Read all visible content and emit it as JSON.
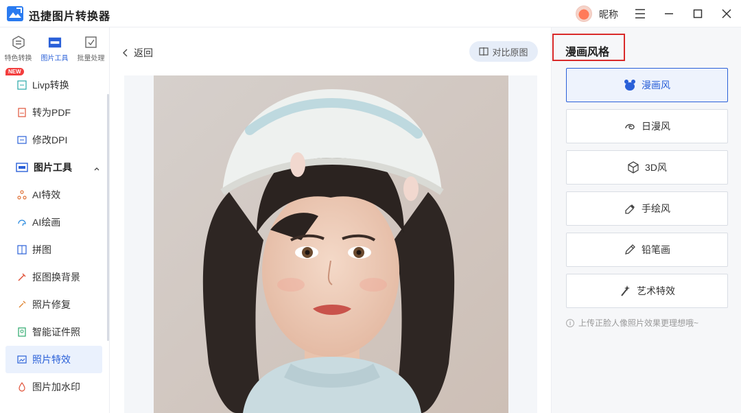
{
  "app": {
    "title": "迅捷图片转换器",
    "user_name": "昵称"
  },
  "rail": {
    "tabs": [
      {
        "label": "特色转换",
        "icon": "convert-icon"
      },
      {
        "label": "图片工具",
        "icon": "image-tools-icon",
        "active": true
      },
      {
        "label": "批量处理",
        "icon": "batch-icon"
      }
    ],
    "items": [
      {
        "label": "Livp转换",
        "icon": "livp-icon",
        "badge": "NEW"
      },
      {
        "label": "转为PDF",
        "icon": "pdf-icon"
      },
      {
        "label": "修改DPI",
        "icon": "dpi-icon"
      },
      {
        "label": "图片工具",
        "icon": "image-tools-icon",
        "section": true
      },
      {
        "label": "AI特效",
        "icon": "ai-effect-icon"
      },
      {
        "label": "AI绘画",
        "icon": "ai-paint-icon"
      },
      {
        "label": "拼图",
        "icon": "collage-icon"
      },
      {
        "label": "抠图换背景",
        "icon": "cutout-icon"
      },
      {
        "label": "照片修复",
        "icon": "repair-icon"
      },
      {
        "label": "智能证件照",
        "icon": "id-photo-icon"
      },
      {
        "label": "照片特效",
        "icon": "photo-effect-icon",
        "selected": true
      },
      {
        "label": "图片加水印",
        "icon": "watermark-icon"
      }
    ]
  },
  "main": {
    "back_label": "返回",
    "compare_label": "对比原图"
  },
  "panel": {
    "title": "漫画风格",
    "styles": [
      {
        "label": "漫画风",
        "icon": "bear-icon",
        "active": true
      },
      {
        "label": "日漫风",
        "icon": "swirl-icon"
      },
      {
        "label": "3D风",
        "icon": "cube-icon"
      },
      {
        "label": "手绘风",
        "icon": "eraser-icon"
      },
      {
        "label": "铅笔画",
        "icon": "pencil-icon"
      },
      {
        "label": "艺术特效",
        "icon": "magic-wand-icon"
      }
    ],
    "tip": "上传正脸人像照片效果更理想哦~"
  },
  "colors": {
    "accent": "#2a60d8",
    "highlight_border": "#d92a2a",
    "badge": "#f33d3d"
  }
}
